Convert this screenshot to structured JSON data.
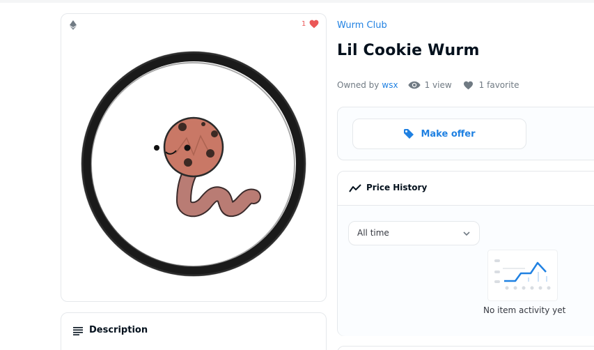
{
  "art_card": {
    "favorite_count": "1"
  },
  "description": {
    "title": "Description"
  },
  "item": {
    "collection": "Wurm Club",
    "title": "Lil Cookie Wurm",
    "owned_by_label": "Owned by",
    "owner": "wsx",
    "views": "1 view",
    "favorites": "1 favorite"
  },
  "offer": {
    "button_label": "Make offer"
  },
  "price_history": {
    "title": "Price History",
    "filter_value": "All time",
    "empty_text": "No item activity yet"
  },
  "colors": {
    "accent": "#2081e2",
    "heart": "#eb5757",
    "border": "#e5e8eb",
    "text": "#04111d",
    "muted": "#707a83"
  },
  "icons": [
    "ethereum-icon",
    "heart-icon",
    "description-icon",
    "eye-icon",
    "tag-icon",
    "trend-icon",
    "chevron-down-icon"
  ]
}
